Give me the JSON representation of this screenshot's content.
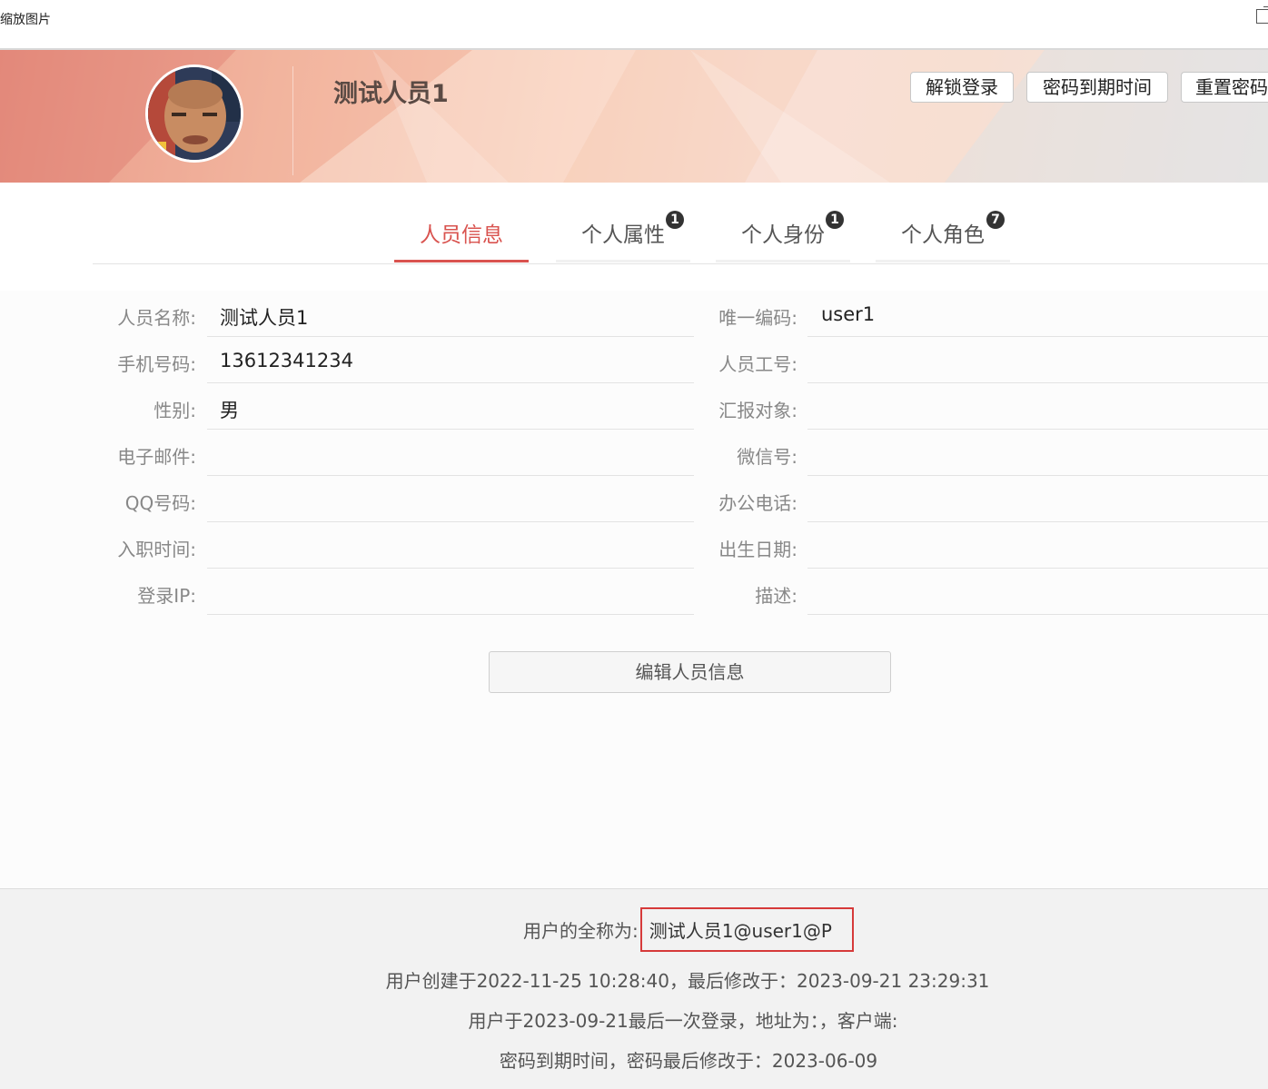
{
  "window": {
    "title": "缩放图片",
    "external_icon": "external-link-icon"
  },
  "header": {
    "user_name": "测试人员1",
    "buttons": {
      "unlock_login": "解锁登录",
      "password_expiry": "密码到期时间",
      "reset_password": "重置密码"
    }
  },
  "tabs": [
    {
      "label": "人员信息",
      "active": true,
      "badge": null
    },
    {
      "label": "个人属性",
      "active": false,
      "badge": "1"
    },
    {
      "label": "个人身份",
      "active": false,
      "badge": "1"
    },
    {
      "label": "个人角色",
      "active": false,
      "badge": "7"
    }
  ],
  "left_fields": [
    {
      "label": "人员名称:",
      "value": "测试人员1"
    },
    {
      "label": "手机号码:",
      "value": "13612341234"
    },
    {
      "label": "性别:",
      "value": "男"
    },
    {
      "label": "电子邮件:",
      "value": ""
    },
    {
      "label": "QQ号码:",
      "value": ""
    },
    {
      "label": "入职时间:",
      "value": ""
    },
    {
      "label": "登录IP:",
      "value": ""
    }
  ],
  "right_fields": [
    {
      "label": "唯一编码:",
      "value": "user1"
    },
    {
      "label": "人员工号:",
      "value": ""
    },
    {
      "label": "汇报对象:",
      "value": ""
    },
    {
      "label": "微信号:",
      "value": ""
    },
    {
      "label": "办公电话:",
      "value": ""
    },
    {
      "label": "出生日期:",
      "value": ""
    },
    {
      "label": "描述:",
      "value": ""
    }
  ],
  "edit_button": "编辑人员信息",
  "footer": {
    "fullname_label": "用户的全称为:",
    "fullname_value": "测试人员1@user1@P",
    "created_line": "用户创建于2022-11-25 10:28:40，最后修改于：2023-09-21 23:29:31",
    "login_line": "用户于2023-09-21最后一次登录，地址为：，客户端:",
    "password_line": "密码到期时间，密码最后修改于：2023-06-09"
  },
  "colors": {
    "accent": "#d9534f",
    "highlight_border": "#d63a3a"
  }
}
